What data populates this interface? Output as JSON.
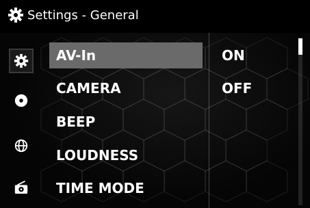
{
  "header": {
    "title": "Settings - General",
    "icon": "gear-icon"
  },
  "sidebar": {
    "items": [
      {
        "icon": "gear-icon",
        "selected": true
      },
      {
        "icon": "disc-icon",
        "selected": false
      },
      {
        "icon": "globe-icon",
        "selected": false
      },
      {
        "icon": "radio-icon",
        "selected": false
      }
    ]
  },
  "menu": {
    "items": [
      {
        "label": "AV-In",
        "value": "ON",
        "selected": true
      },
      {
        "label": "CAMERA",
        "value": "OFF",
        "selected": false
      },
      {
        "label": "BEEP",
        "value": "",
        "selected": false
      },
      {
        "label": "LOUDNESS",
        "value": "",
        "selected": false
      },
      {
        "label": "TIME MODE",
        "value": "",
        "selected": false
      }
    ]
  },
  "scrollbar": {
    "position_fraction": 0.0,
    "visible_fraction": 0.1
  },
  "colors": {
    "selected_background": "#6a6a6a",
    "text": "#ffffff",
    "background": "#000000"
  }
}
